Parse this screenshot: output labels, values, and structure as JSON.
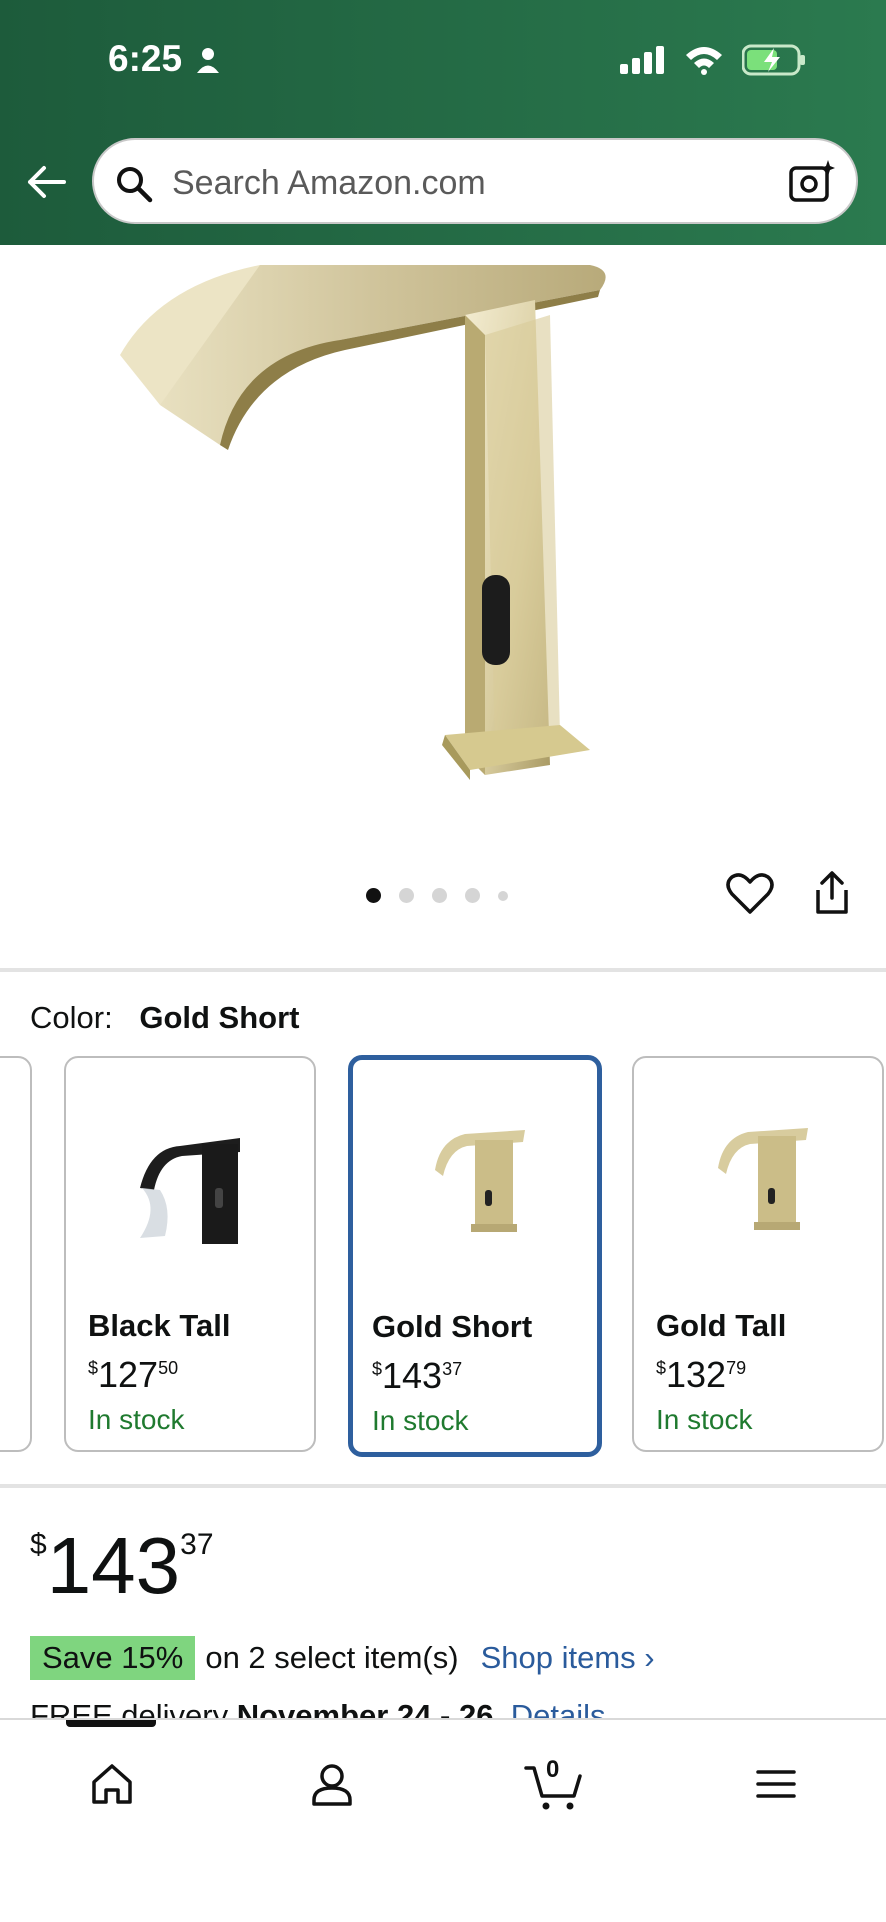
{
  "status_bar": {
    "time": "6:25"
  },
  "search": {
    "placeholder": "Search Amazon.com"
  },
  "gallery": {
    "image_count": 5,
    "active_index": 0
  },
  "color_selector": {
    "label": "Color:",
    "selected": "Gold Short",
    "options": [
      {
        "name": "Black Tall",
        "price_dollar": "$",
        "price_whole": "127",
        "price_cents": "50",
        "stock": "In stock"
      },
      {
        "name": "Gold Short",
        "price_dollar": "$",
        "price_whole": "143",
        "price_cents": "37",
        "stock": "In stock"
      },
      {
        "name": "Gold Tall",
        "price_dollar": "$",
        "price_whole": "132",
        "price_cents": "79",
        "stock": "In stock"
      }
    ]
  },
  "price": {
    "currency": "$",
    "whole": "143",
    "cents": "37"
  },
  "promo": {
    "badge": "Save 15%",
    "text": "on 2 select item(s)",
    "link": "Shop items ›"
  },
  "delivery": {
    "prefix": "FREE delivery",
    "dates": "November 24 - 26",
    "suffix": ".",
    "link": "Details"
  },
  "cart": {
    "count": "0"
  },
  "colors": {
    "header_start": "#1d5b3b",
    "header_end": "#2b7a4f",
    "selected_border": "#2e5f9e",
    "stock_green": "#1f7a2f",
    "link_blue": "#2a5b9c",
    "save_badge": "#7fd57f"
  }
}
